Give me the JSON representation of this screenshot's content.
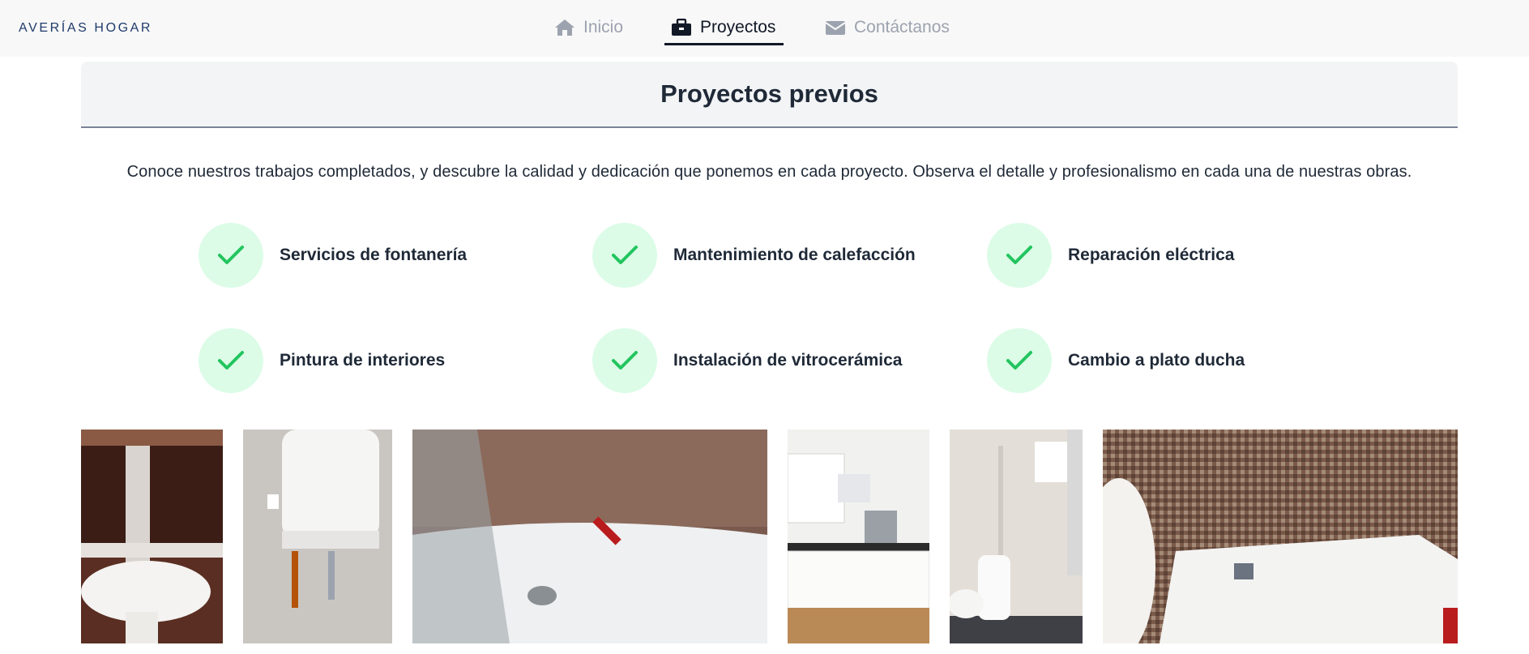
{
  "navbar": {
    "brand": "AVERÍAS HOGAR",
    "links": [
      {
        "label": "Inicio",
        "icon": "home-icon",
        "active": false
      },
      {
        "label": "Proyectos",
        "icon": "briefcase-icon",
        "active": true
      },
      {
        "label": "Contáctanos",
        "icon": "envelope-icon",
        "active": false
      }
    ]
  },
  "section": {
    "title": "Proyectos previos",
    "intro": "Conoce nuestros trabajos completados, y descubre la calidad y dedicación que ponemos en cada proyecto. Observa el detalle y profesionalismo en cada una de nuestras obras."
  },
  "features": [
    {
      "label": "Servicios de fontanería",
      "icon": "check-icon"
    },
    {
      "label": "Mantenimiento de calefacción",
      "icon": "check-icon"
    },
    {
      "label": "Reparación eléctrica",
      "icon": "check-icon"
    },
    {
      "label": "Pintura de interiores",
      "icon": "check-icon"
    },
    {
      "label": "Instalación de vitrocerámica",
      "icon": "check-icon"
    },
    {
      "label": "Cambio a plato ducha",
      "icon": "check-icon"
    }
  ],
  "gallery": [
    {
      "subject": "bathroom-sink-photo"
    },
    {
      "subject": "water-heater-photo"
    },
    {
      "subject": "bathtub-photo"
    },
    {
      "subject": "kitchen-photo"
    },
    {
      "subject": "bathroom-toilet-shower-photo"
    },
    {
      "subject": "shower-tray-photo"
    }
  ],
  "colors": {
    "brand": "#1f3a6b",
    "check": "#22c55e",
    "check_bg": "#dcfce7",
    "nav_inactive": "#9ca3af",
    "nav_active": "#111827"
  }
}
